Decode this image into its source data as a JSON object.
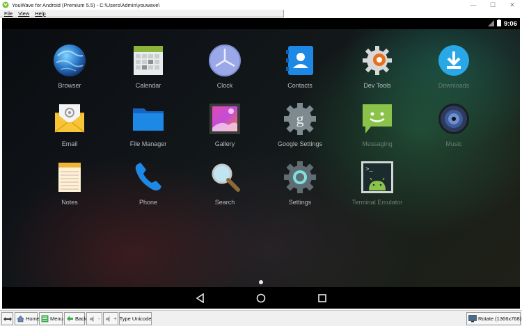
{
  "window": {
    "title": "YouWave for Android (Premium 5.5) - C:\\Users\\Admin\\youwave\\",
    "controls": {
      "minimize": "—",
      "maximize": "☐",
      "close": "✕"
    }
  },
  "menubar": {
    "items": [
      {
        "label": "File"
      },
      {
        "label": "View"
      },
      {
        "label": "Help"
      }
    ]
  },
  "statusbar": {
    "time": "9:06",
    "icons": [
      "signal-icon",
      "battery-icon"
    ]
  },
  "apps": [
    {
      "label": "Browser",
      "icon": "browser-icon"
    },
    {
      "label": "Calendar",
      "icon": "calendar-icon"
    },
    {
      "label": "Clock",
      "icon": "clock-icon"
    },
    {
      "label": "Contacts",
      "icon": "contacts-icon"
    },
    {
      "label": "Dev Tools",
      "icon": "dev-tools-icon"
    },
    {
      "label": "Downloads",
      "icon": "downloads-icon"
    },
    {
      "label": "Email",
      "icon": "email-icon"
    },
    {
      "label": "File Manager",
      "icon": "file-manager-icon"
    },
    {
      "label": "Gallery",
      "icon": "gallery-icon"
    },
    {
      "label": "Google Settings",
      "icon": "google-settings-icon"
    },
    {
      "label": "Messaging",
      "icon": "messaging-icon"
    },
    {
      "label": "Music",
      "icon": "music-icon"
    },
    {
      "label": "Notes",
      "icon": "notes-icon"
    },
    {
      "label": "Phone",
      "icon": "phone-icon"
    },
    {
      "label": "Search",
      "icon": "search-icon"
    },
    {
      "label": "Settings",
      "icon": "settings-icon"
    },
    {
      "label": "Terminal Emulator",
      "icon": "terminal-icon"
    }
  ],
  "navbar": {
    "buttons": [
      "back-icon",
      "home-icon",
      "recents-icon"
    ]
  },
  "toolbar": {
    "arrows_icon": "double-arrow-icon",
    "home_label": "Home",
    "menu_label": "Menu",
    "back_label": "Back",
    "vol_down_label": "-",
    "vol_up_label": "+",
    "type_unicode_label": "Type Unicode",
    "rotate_label": "Rotate (1366x768)"
  },
  "colors": {
    "accent_blue": "#1e88e5",
    "text_label": "#b8bcc0",
    "statusbar_bg": "#000000"
  }
}
